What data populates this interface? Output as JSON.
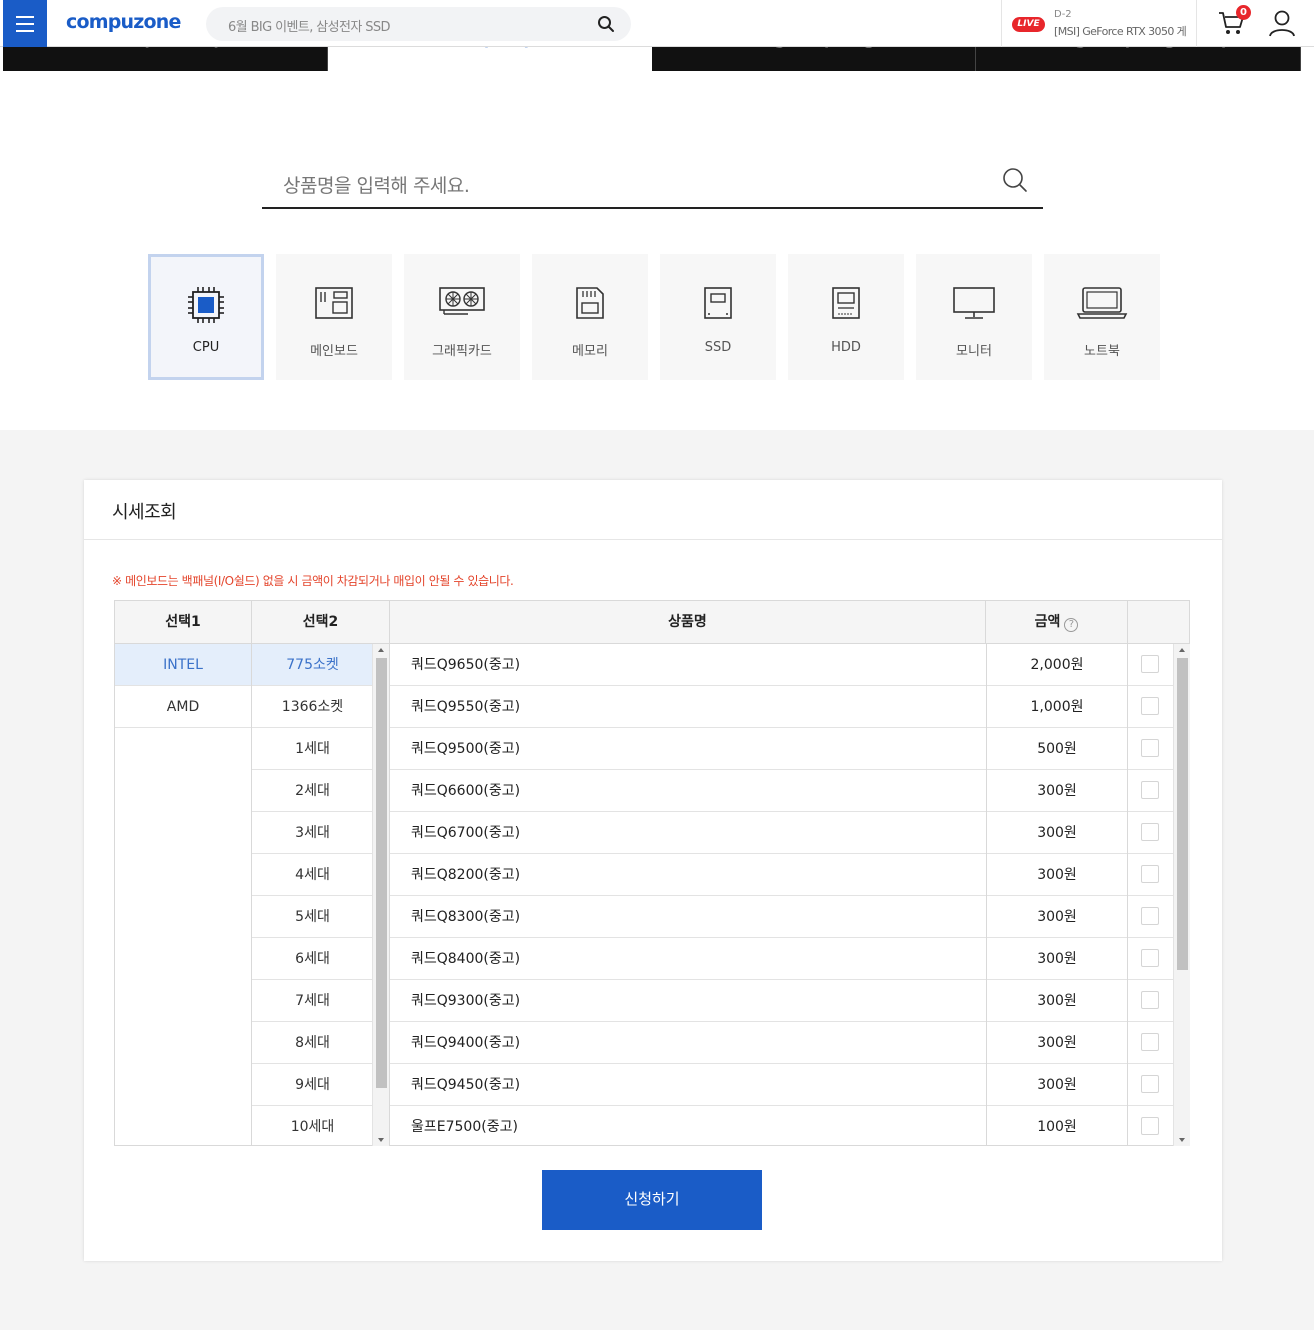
{
  "header": {
    "logo": "compuzone",
    "search_placeholder": "6월 BIG 이벤트, 삼성전자 SSD",
    "live": {
      "badge": "LIVE",
      "d_day": "D-2",
      "title": "[MSI] GeForce RTX 3050 게"
    },
    "cart_count": "0"
  },
  "tabs": [
    {
      "label": "시리즈 안내",
      "active": false
    },
    {
      "label": "시세조회",
      "active": true
    },
    {
      "label": "고장판매 신청",
      "active": false
    },
    {
      "label": "고장판매 신청 안내",
      "active": false
    }
  ],
  "product_search": {
    "placeholder": "상품명을 입력해 주세요."
  },
  "categories": [
    {
      "label": "CPU",
      "icon": "cpu-icon",
      "active": true
    },
    {
      "label": "메인보드",
      "icon": "mainboard-icon",
      "active": false
    },
    {
      "label": "그래픽카드",
      "icon": "graphics-card-icon",
      "active": false
    },
    {
      "label": "메모리",
      "icon": "memory-icon",
      "active": false
    },
    {
      "label": "SSD",
      "icon": "ssd-icon",
      "active": false
    },
    {
      "label": "HDD",
      "icon": "hdd-icon",
      "active": false
    },
    {
      "label": "모니터",
      "icon": "monitor-icon",
      "active": false
    },
    {
      "label": "노트북",
      "icon": "laptop-icon",
      "active": false
    }
  ],
  "panel": {
    "title": "시세조회",
    "notice": "※ 메인보드는 백패널(I/O쉴드) 없을 시 금액이 차감되거나 매입이 안될 수 있습니다.",
    "headers": {
      "select1": "선택1",
      "select2": "선택2",
      "product": "상품명",
      "price": "금액"
    },
    "select1": [
      {
        "label": "INTEL",
        "selected": true
      },
      {
        "label": "AMD",
        "selected": false
      }
    ],
    "select2": [
      {
        "label": "775소켓",
        "selected": true
      },
      {
        "label": "1366소켓",
        "selected": false
      },
      {
        "label": "1세대",
        "selected": false
      },
      {
        "label": "2세대",
        "selected": false
      },
      {
        "label": "3세대",
        "selected": false
      },
      {
        "label": "4세대",
        "selected": false
      },
      {
        "label": "5세대",
        "selected": false
      },
      {
        "label": "6세대",
        "selected": false
      },
      {
        "label": "7세대",
        "selected": false
      },
      {
        "label": "8세대",
        "selected": false
      },
      {
        "label": "9세대",
        "selected": false
      },
      {
        "label": "10세대",
        "selected": false
      }
    ],
    "products": [
      {
        "name": "쿼드Q9650(중고)",
        "price": "2,000원"
      },
      {
        "name": "쿼드Q9550(중고)",
        "price": "1,000원"
      },
      {
        "name": "쿼드Q9500(중고)",
        "price": "500원"
      },
      {
        "name": "쿼드Q6600(중고)",
        "price": "300원"
      },
      {
        "name": "쿼드Q6700(중고)",
        "price": "300원"
      },
      {
        "name": "쿼드Q8200(중고)",
        "price": "300원"
      },
      {
        "name": "쿼드Q8300(중고)",
        "price": "300원"
      },
      {
        "name": "쿼드Q8400(중고)",
        "price": "300원"
      },
      {
        "name": "쿼드Q9300(중고)",
        "price": "300원"
      },
      {
        "name": "쿼드Q9400(중고)",
        "price": "300원"
      },
      {
        "name": "쿼드Q9450(중고)",
        "price": "300원"
      },
      {
        "name": "울프E7500(중고)",
        "price": "100원"
      }
    ],
    "apply_label": "신청하기"
  },
  "colors": {
    "brand": "#1a5cc7",
    "notice": "#e4452c",
    "live": "#e8262b",
    "selected_bg": "#e4eefb"
  }
}
